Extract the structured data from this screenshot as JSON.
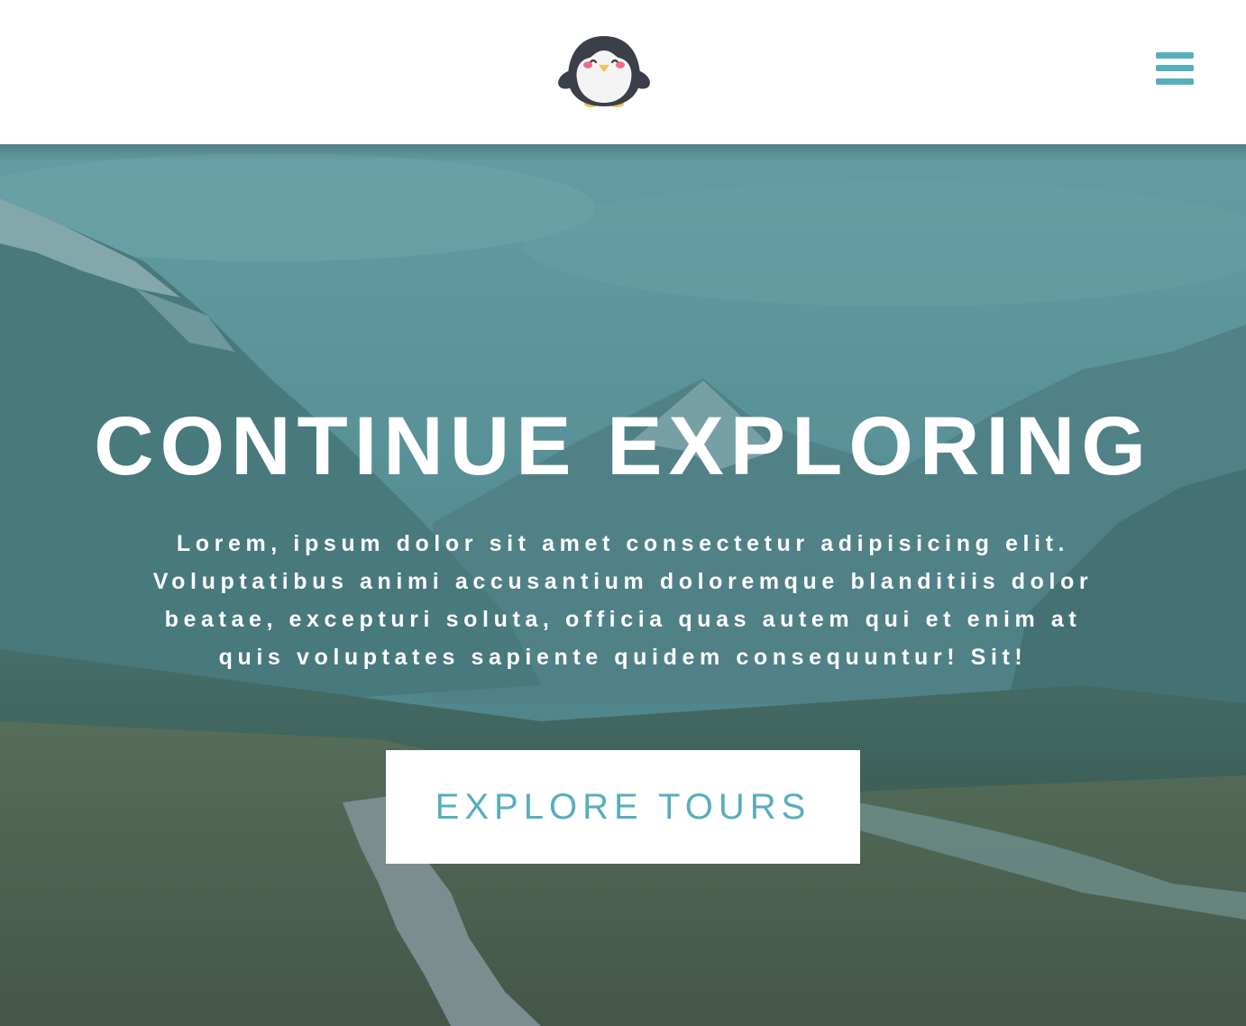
{
  "brand": {
    "accent_color": "#57aebd",
    "logo_icon": "penguin-icon"
  },
  "header": {
    "menu_icon": "hamburger-menu-icon"
  },
  "hero": {
    "title": "CONTINUE EXPLORING",
    "description": "Lorem, ipsum dolor sit amet consectetur adipisicing elit. Voluptatibus animi accusantium doloremque blanditiis dolor beatae, excepturi soluta, officia quas autem qui et enim at quis voluptates sapiente quidem consequuntur! Sit!",
    "cta_label": "EXPLORE TOURS",
    "overlay_color": "#3f7f87"
  }
}
